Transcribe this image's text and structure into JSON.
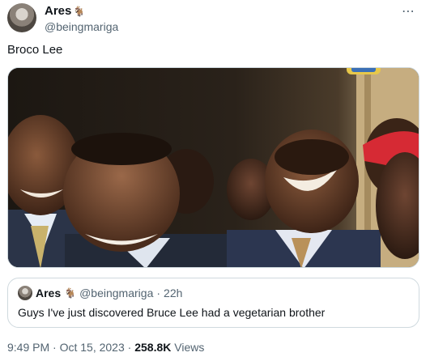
{
  "author": {
    "display_name": "Ares",
    "name_icon": "goat-emoji",
    "name_glyph": "🐐",
    "handle": "@beingmariga"
  },
  "tweet": {
    "text": "Broco Lee",
    "media": {
      "description_icon": "photo-laughing-men"
    }
  },
  "quoted_tweet": {
    "display_name": "Ares",
    "name_glyph": "🐐",
    "handle": "@beingmariga",
    "separator": "·",
    "age": "22h",
    "text": "Guys I've just discovered Bruce Lee had a vegetarian brother"
  },
  "footer": {
    "time": "9:49 PM",
    "separator1": "·",
    "date": "Oct 15, 2023",
    "separator2": "·",
    "views_count": "258.8K",
    "views_label": "Views"
  },
  "icons": {
    "more": "⋯"
  },
  "colors": {
    "text_primary": "#0f1419",
    "text_secondary": "#536471",
    "border": "#cfd9de"
  }
}
